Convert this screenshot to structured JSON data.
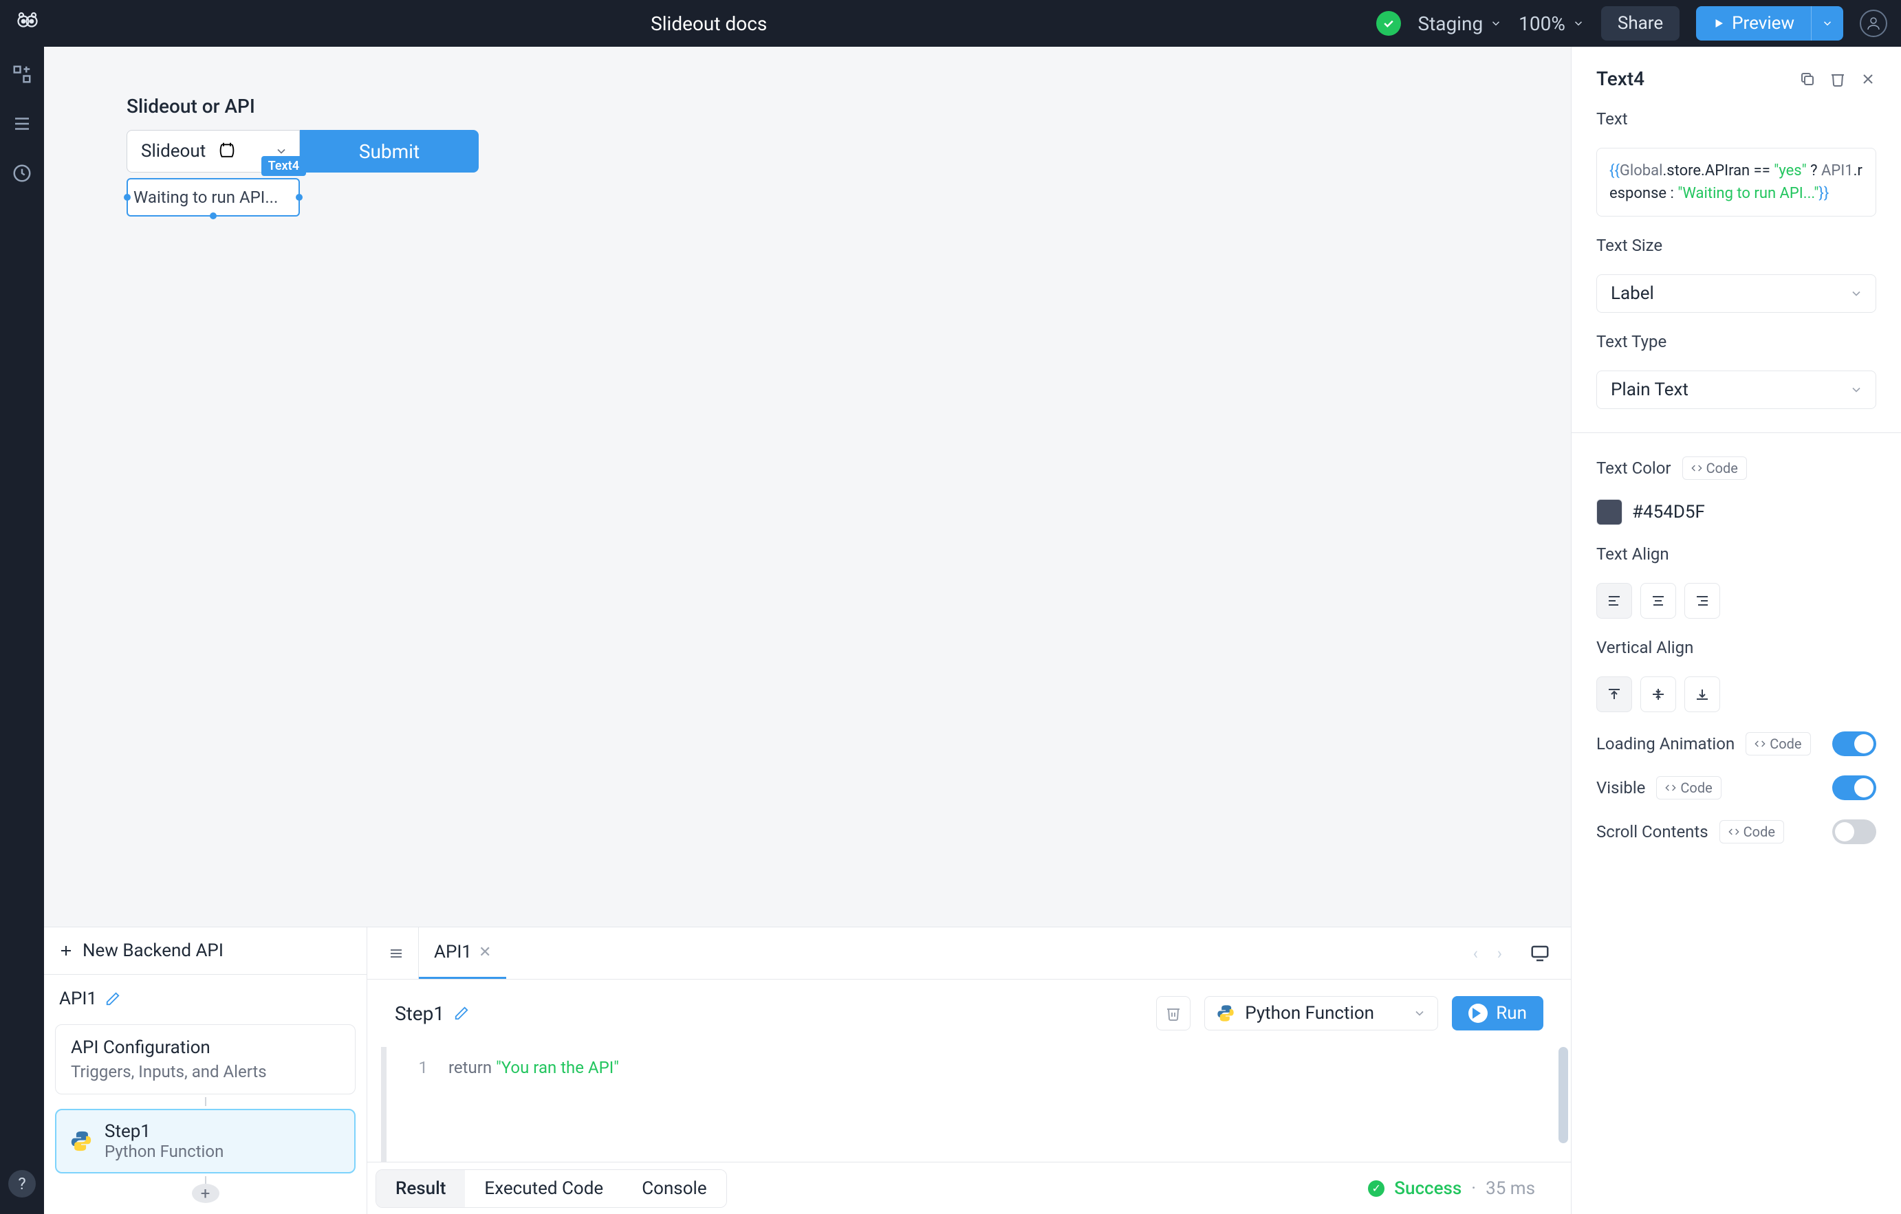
{
  "topbar": {
    "title": "Slideout docs",
    "environment": "Staging",
    "zoom": "100%",
    "share_label": "Share",
    "preview_label": "Preview"
  },
  "canvas": {
    "heading": "Slideout or API",
    "dropdown_value": "Slideout",
    "submit_label": "Submit",
    "selected_tag": "Text4",
    "text_value": "Waiting to run API..."
  },
  "api_panel": {
    "new_api_label": "New Backend API",
    "api_name": "API1",
    "tab_name": "API1",
    "config_title": "API Configuration",
    "config_subtitle": "Triggers, Inputs, and Alerts",
    "step_name": "Step1",
    "step_type": "Python Function",
    "header_step_name": "Step1",
    "func_type": "Python Function",
    "run_label": "Run",
    "code_keyword": "return",
    "code_string": "\"You ran the API\"",
    "result_tabs": {
      "result": "Result",
      "executed": "Executed Code",
      "console": "Console"
    },
    "status_label": "Success",
    "status_time": "35 ms"
  },
  "inspector": {
    "component_name": "Text4",
    "section_text": "Text",
    "text_size_label": "Text Size",
    "text_size_value": "Label",
    "text_type_label": "Text Type",
    "text_type_value": "Plain Text",
    "text_color_label": "Text Color",
    "text_color_value": "#454D5F",
    "text_align_label": "Text Align",
    "vertical_align_label": "Vertical Align",
    "loading_label": "Loading Animation",
    "visible_label": "Visible",
    "scroll_label": "Scroll Contents",
    "code_badge": "Code",
    "expr": {
      "p1": "{{",
      "p2": "Global",
      "p3": ".store.APIran == ",
      "p4": "\"yes\"",
      "p5": " ? ",
      "p6": "API1",
      "p7": ".response : ",
      "p8": "\"Waiting to run API...\"",
      "p9": "}}"
    }
  }
}
